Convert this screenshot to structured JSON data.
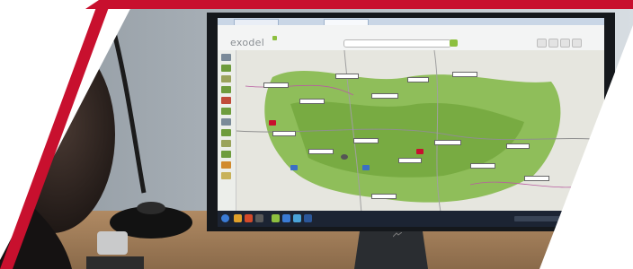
{
  "app": {
    "logo_text": "exodel"
  },
  "colors": {
    "brand_red": "#c8102e",
    "accent_green": "#8dbf3f",
    "map_green": "#7fb24a",
    "taskbar": "#1c2433"
  },
  "icons": {
    "logo": "exodel-logo",
    "search": "search-icon",
    "monitor_brand": "monitor-logo-icon"
  }
}
